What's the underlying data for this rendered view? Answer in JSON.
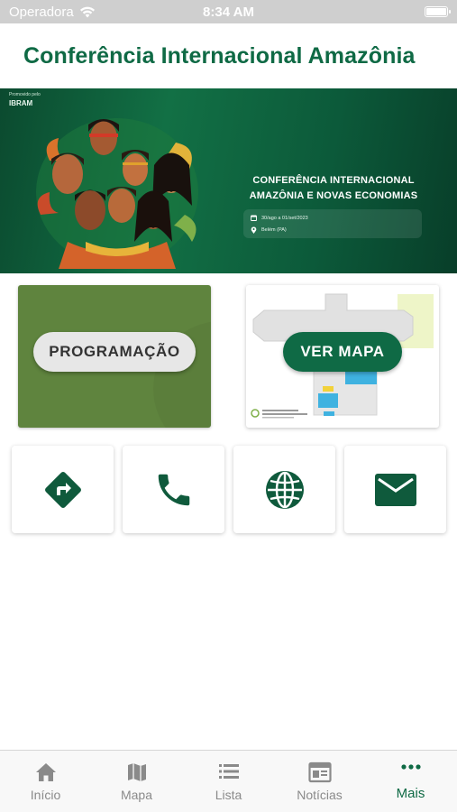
{
  "status_bar": {
    "carrier": "Operadora",
    "time": "8:34 AM"
  },
  "header": {
    "title": "Conferência Internacional Amazônia"
  },
  "banner": {
    "promoted_by": "Promovido pelo",
    "logo_text": "IBRAM",
    "title_line1": "CONFERÊNCIA INTERNACIONAL",
    "title_line2": "AMAZÔNIA E NOVAS ECONOMIAS",
    "dates": "30/ago a 01/set/2023",
    "location": "Belém (PA)"
  },
  "cards": {
    "programacao_label": "PROGRAMAÇÃO",
    "ver_mapa_label": "VER MAPA"
  },
  "actions": [
    {
      "name": "directions",
      "icon": "directions-icon"
    },
    {
      "name": "phone",
      "icon": "phone-icon"
    },
    {
      "name": "website",
      "icon": "globe-icon"
    },
    {
      "name": "email",
      "icon": "mail-icon"
    }
  ],
  "tab_bar": {
    "items": [
      {
        "label": "Início",
        "icon": "home-icon"
      },
      {
        "label": "Mapa",
        "icon": "map-icon"
      },
      {
        "label": "Lista",
        "icon": "list-icon"
      },
      {
        "label": "Notícias",
        "icon": "newspaper-icon"
      },
      {
        "label": "Mais",
        "icon": "more-icon",
        "active": true
      }
    ]
  },
  "colors": {
    "brand_green": "#0f6a45",
    "programacao_bg": "#5f843e",
    "tab_inactive": "#8a8a8a"
  }
}
